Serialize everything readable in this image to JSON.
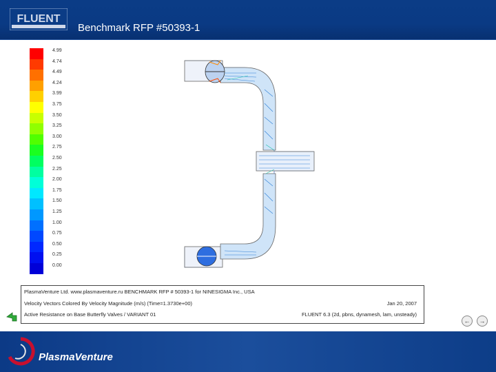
{
  "header": {
    "logo_text": "FLUENT",
    "title": "Benchmark  RFP #50393-1"
  },
  "colors": {
    "header_blue": "#0b3c86",
    "footer_blue": "#0c3a86",
    "accent_red": "#c8102e"
  },
  "legend": {
    "labels": [
      "4.99",
      "4.74",
      "4.49",
      "4.24",
      "3.99",
      "3.75",
      "3.50",
      "3.25",
      "3.00",
      "2.75",
      "2.50",
      "2.25",
      "2.00",
      "1.75",
      "1.50",
      "1.25",
      "1.00",
      "0.75",
      "0.50",
      "0.25",
      "0.00"
    ],
    "colors": [
      "#ff0000",
      "#ff3a00",
      "#ff7000",
      "#ffa000",
      "#ffd000",
      "#ffff00",
      "#c8ff00",
      "#90ff00",
      "#50ff00",
      "#1aff20",
      "#00ff60",
      "#00ffa0",
      "#00ffd8",
      "#00e8ff",
      "#00c0ff",
      "#0098ff",
      "#0070ff",
      "#0048ff",
      "#0028ff",
      "#0010f0",
      "#0000d8"
    ]
  },
  "plot_info": {
    "line1": "PlasmaVenture Ltd. www.plasmaventure.ru  BENCHMARK RFP # 50393-1 for  NINESIGMA Inc., USA",
    "line2": "Velocity Vectors Colored By Velocity Magnitude (m/s)  (Time=1.3730e+00)",
    "line2_right": "Jan 20, 2007",
    "line3": "Active Resistance on Base Butterfly Valves  / VARIANT 01",
    "line3_right": "FLUENT 6.3 (2d, pbns, dynamesh, lam, unsteady)"
  },
  "footer": {
    "brand": "PlasmaVenture"
  },
  "navigation": {
    "prev_icon": "prev-slide-icon",
    "next_icon": "next-slide-icon",
    "back_icon": "back-arrow-icon"
  }
}
